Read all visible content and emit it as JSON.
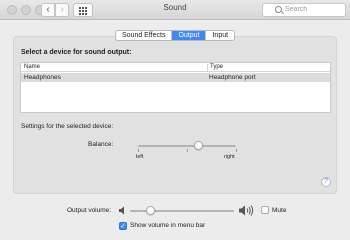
{
  "window": {
    "title": "Sound"
  },
  "toolbar": {
    "back_icon": "chevron-left-icon",
    "forward_icon": "chevron-right-icon",
    "grid_icon": "grid-icon"
  },
  "search": {
    "placeholder": "Search"
  },
  "tabs": [
    {
      "label": "Sound Effects",
      "active": false
    },
    {
      "label": "Output",
      "active": true
    },
    {
      "label": "Input",
      "active": false
    }
  ],
  "output": {
    "prompt": "Select a device for sound output:",
    "columns": {
      "name": "Name",
      "type": "Type"
    },
    "devices": [
      {
        "name": "Headphones",
        "type": "Headphone port",
        "selected": true
      }
    ],
    "settings_label": "Settings for the selected device:",
    "balance": {
      "label": "Balance:",
      "left": "left",
      "right": "right",
      "value": 0.58
    }
  },
  "footer": {
    "volume_label": "Output volume:",
    "volume_value": 0.18,
    "mute_label": "Mute",
    "mute_checked": false,
    "show_volume_label": "Show volume in menu bar",
    "show_volume_checked": true
  },
  "colors": {
    "accent": "#3d8af7"
  }
}
